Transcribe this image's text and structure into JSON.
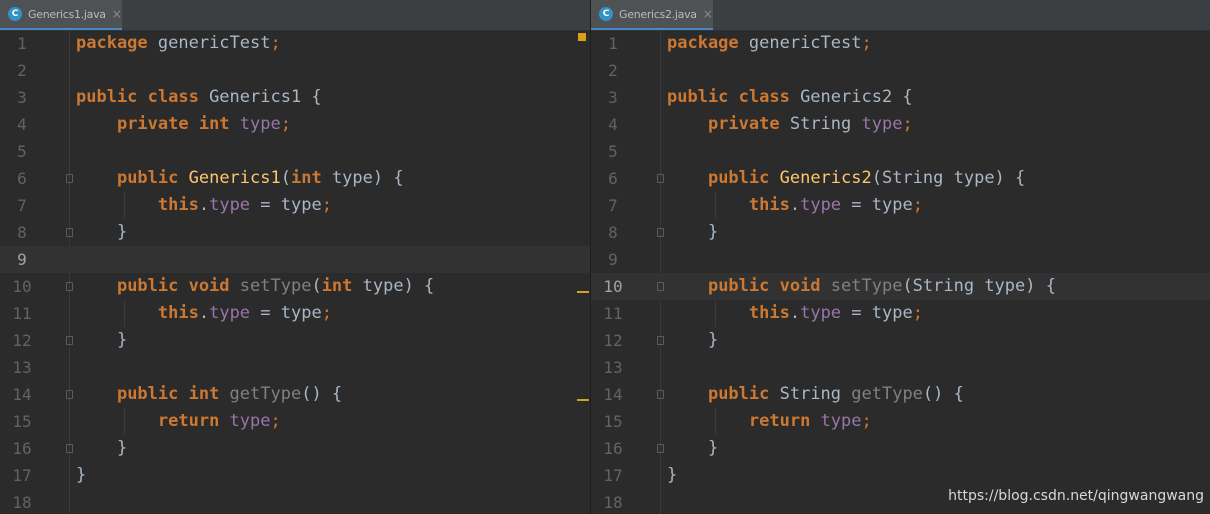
{
  "left": {
    "tab": {
      "icon": "java-class-icon",
      "icon_letter": "C",
      "label": "Generics1.java",
      "close": "×"
    },
    "lines": [
      {
        "n": "1",
        "tokens": [
          [
            "kw",
            "package "
          ],
          [
            "plain",
            "genericTest"
          ],
          [
            "semi",
            ";"
          ]
        ]
      },
      {
        "n": "2",
        "tokens": []
      },
      {
        "n": "3",
        "tokens": [
          [
            "kw",
            "public class "
          ],
          [
            "plain",
            "Generics1 {"
          ]
        ]
      },
      {
        "n": "4",
        "tokens": [
          [
            "plain",
            "    "
          ],
          [
            "kw",
            "private int "
          ],
          [
            "field",
            "type"
          ],
          [
            "semi",
            ";"
          ]
        ]
      },
      {
        "n": "5",
        "tokens": []
      },
      {
        "n": "6",
        "tokens": [
          [
            "plain",
            "    "
          ],
          [
            "kw",
            "public "
          ],
          [
            "fn",
            "Generics1"
          ],
          [
            "plain",
            "("
          ],
          [
            "kw",
            "int "
          ],
          [
            "plain",
            "type) {"
          ]
        ]
      },
      {
        "n": "7",
        "tokens": [
          [
            "plain",
            "        "
          ],
          [
            "kw",
            "this"
          ],
          [
            "plain",
            "."
          ],
          [
            "field",
            "type"
          ],
          [
            "plain",
            " = type"
          ],
          [
            "semi",
            ";"
          ]
        ]
      },
      {
        "n": "8",
        "tokens": [
          [
            "plain",
            "    }"
          ]
        ]
      },
      {
        "n": "9",
        "tokens": []
      },
      {
        "n": "10",
        "tokens": [
          [
            "plain",
            "    "
          ],
          [
            "kw",
            "public void "
          ],
          [
            "method",
            "setType"
          ],
          [
            "plain",
            "("
          ],
          [
            "kw",
            "int "
          ],
          [
            "plain",
            "type) {"
          ]
        ]
      },
      {
        "n": "11",
        "tokens": [
          [
            "plain",
            "        "
          ],
          [
            "kw",
            "this"
          ],
          [
            "plain",
            "."
          ],
          [
            "field",
            "type"
          ],
          [
            "plain",
            " = type"
          ],
          [
            "semi",
            ";"
          ]
        ]
      },
      {
        "n": "12",
        "tokens": [
          [
            "plain",
            "    }"
          ]
        ]
      },
      {
        "n": "13",
        "tokens": []
      },
      {
        "n": "14",
        "tokens": [
          [
            "plain",
            "    "
          ],
          [
            "kw",
            "public int "
          ],
          [
            "method",
            "getType"
          ],
          [
            "plain",
            "() {"
          ]
        ]
      },
      {
        "n": "15",
        "tokens": [
          [
            "plain",
            "        "
          ],
          [
            "kw",
            "return "
          ],
          [
            "field",
            "type"
          ],
          [
            "semi",
            ";"
          ]
        ]
      },
      {
        "n": "16",
        "tokens": [
          [
            "plain",
            "    }"
          ]
        ]
      },
      {
        "n": "17",
        "tokens": [
          [
            "plain",
            "}"
          ]
        ]
      },
      {
        "n": "18",
        "tokens": []
      }
    ]
  },
  "right": {
    "tab": {
      "icon": "java-class-icon",
      "icon_letter": "C",
      "label": "Generics2.java",
      "close": "×"
    },
    "lines": [
      {
        "n": "1",
        "tokens": [
          [
            "kw",
            "package "
          ],
          [
            "plain",
            "genericTest"
          ],
          [
            "semi",
            ";"
          ]
        ]
      },
      {
        "n": "2",
        "tokens": []
      },
      {
        "n": "3",
        "tokens": [
          [
            "kw",
            "public class "
          ],
          [
            "plain",
            "Generics2 {"
          ]
        ]
      },
      {
        "n": "4",
        "tokens": [
          [
            "plain",
            "    "
          ],
          [
            "kw",
            "private "
          ],
          [
            "plain",
            "String "
          ],
          [
            "field",
            "type"
          ],
          [
            "semi",
            ";"
          ]
        ]
      },
      {
        "n": "5",
        "tokens": []
      },
      {
        "n": "6",
        "tokens": [
          [
            "plain",
            "    "
          ],
          [
            "kw",
            "public "
          ],
          [
            "fn",
            "Generics2"
          ],
          [
            "plain",
            "(String type) {"
          ]
        ]
      },
      {
        "n": "7",
        "tokens": [
          [
            "plain",
            "        "
          ],
          [
            "kw",
            "this"
          ],
          [
            "plain",
            "."
          ],
          [
            "field",
            "type"
          ],
          [
            "plain",
            " = type"
          ],
          [
            "semi",
            ";"
          ]
        ]
      },
      {
        "n": "8",
        "tokens": [
          [
            "plain",
            "    }"
          ]
        ]
      },
      {
        "n": "9",
        "tokens": []
      },
      {
        "n": "10",
        "tokens": [
          [
            "plain",
            "    "
          ],
          [
            "kw",
            "public void "
          ],
          [
            "method",
            "setType"
          ],
          [
            "plain",
            "(String type) {"
          ]
        ]
      },
      {
        "n": "11",
        "tokens": [
          [
            "plain",
            "        "
          ],
          [
            "kw",
            "this"
          ],
          [
            "plain",
            "."
          ],
          [
            "field",
            "type"
          ],
          [
            "plain",
            " = type"
          ],
          [
            "semi",
            ";"
          ]
        ]
      },
      {
        "n": "12",
        "tokens": [
          [
            "plain",
            "    }"
          ]
        ]
      },
      {
        "n": "13",
        "tokens": []
      },
      {
        "n": "14",
        "tokens": [
          [
            "plain",
            "    "
          ],
          [
            "kw",
            "public "
          ],
          [
            "plain",
            "String "
          ],
          [
            "method",
            "getType"
          ],
          [
            "plain",
            "() {"
          ]
        ]
      },
      {
        "n": "15",
        "tokens": [
          [
            "plain",
            "        "
          ],
          [
            "kw",
            "return "
          ],
          [
            "field",
            "type"
          ],
          [
            "semi",
            ";"
          ]
        ]
      },
      {
        "n": "16",
        "tokens": [
          [
            "plain",
            "    }"
          ]
        ]
      },
      {
        "n": "17",
        "tokens": [
          [
            "plain",
            "}"
          ]
        ]
      },
      {
        "n": "18",
        "tokens": []
      }
    ]
  },
  "watermark": "https://blog.csdn.net/qingwangwang",
  "colors": {
    "background": "#2b2b2b",
    "keyword": "#cc7832",
    "function_decl": "#ffc66d",
    "field": "#9876aa",
    "text": "#a9b7c6",
    "line_number": "#606366",
    "diff_marker": "#d6a21b"
  }
}
